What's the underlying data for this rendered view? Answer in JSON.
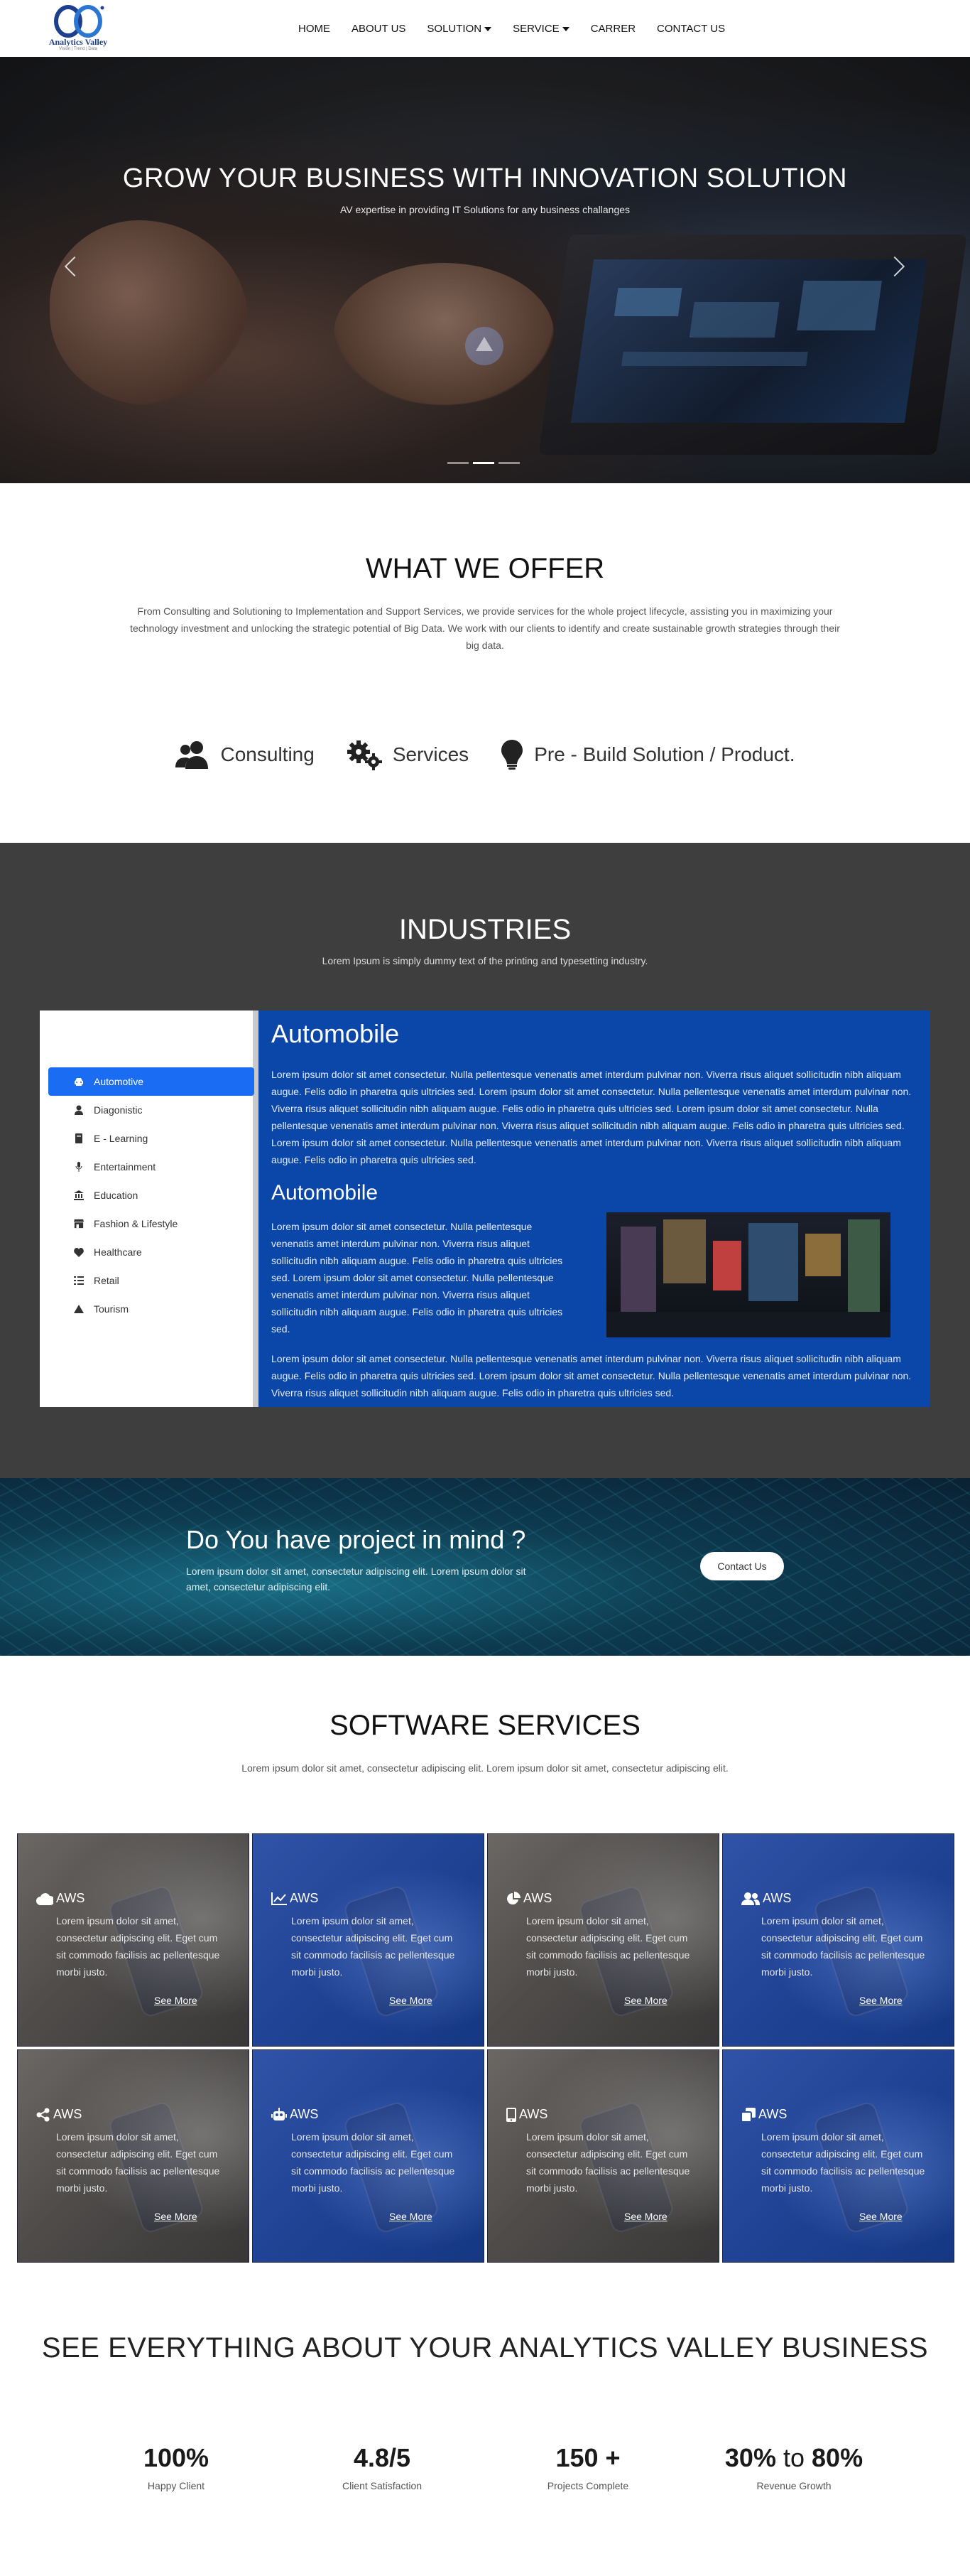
{
  "nav": {
    "logo_name": "Analytics Valley",
    "logo_tagline": "Vision | Trend | Data",
    "items": [
      {
        "label": "HOME",
        "dropdown": false
      },
      {
        "label": "ABOUT US",
        "dropdown": false
      },
      {
        "label": "SOLUTION",
        "dropdown": true
      },
      {
        "label": "SERVICE",
        "dropdown": true
      },
      {
        "label": "CARRER",
        "dropdown": false
      },
      {
        "label": "CONTACT US",
        "dropdown": false
      }
    ]
  },
  "hero": {
    "title": "GROW YOUR BUSINESS WITH INNOVATION SOLUTION",
    "subtitle": "AV expertise in providing IT Solutions for any business challanges",
    "slides": 3,
    "active_slide": 1
  },
  "offer": {
    "title": "WHAT WE OFFER",
    "text": "From Consulting and Solutioning to Implementation and Support Services, we provide services for the whole project lifecycle, assisting you in maximizing your technology investment and unlocking the strategic potential of Big Data. We work with our clients to identify and create sustainable growth strategies through their big data.",
    "items": [
      {
        "label": "Consulting",
        "icon": "users-icon"
      },
      {
        "label": "Services",
        "icon": "gears-icon"
      },
      {
        "label": "Pre - Build Solution / Product.",
        "icon": "lightbulb-icon"
      }
    ]
  },
  "industries": {
    "title": "INDUSTRIES",
    "subtitle": "Lorem Ipsum is simply dummy text of the printing and typesetting industry.",
    "items": [
      {
        "label": "Automotive",
        "icon": "car-icon",
        "active": true
      },
      {
        "label": "Diagonistic",
        "icon": "user-icon",
        "active": false
      },
      {
        "label": "E - Learning",
        "icon": "book-icon",
        "active": false
      },
      {
        "label": "Entertainment",
        "icon": "microphone-icon",
        "active": false
      },
      {
        "label": "Education",
        "icon": "university-icon",
        "active": false
      },
      {
        "label": "Fashion & Lifestyle",
        "icon": "store-icon",
        "active": false
      },
      {
        "label": "Healthcare",
        "icon": "heart-icon",
        "active": false
      },
      {
        "label": "Retail",
        "icon": "list-icon",
        "active": false
      },
      {
        "label": "Tourism",
        "icon": "mountain-icon",
        "active": false
      }
    ],
    "panel": {
      "heading": "Automobile",
      "para1": "Lorem ipsum dolor sit amet consectetur. Nulla pellentesque venenatis amet interdum pulvinar non. Viverra risus aliquet sollicitudin nibh aliquam augue. Felis odio in pharetra quis ultricies sed. Lorem ipsum dolor sit amet consectetur. Nulla pellentesque venenatis amet interdum pulvinar non. Viverra risus aliquet sollicitudin nibh aliquam augue. Felis odio in pharetra quis ultricies sed. Lorem ipsum dolor sit amet consectetur. Nulla pellentesque venenatis amet interdum pulvinar non. Viverra risus aliquet sollicitudin nibh aliquam augue. Felis odio in pharetra quis ultricies sed. Lorem ipsum dolor sit amet consectetur. Nulla pellentesque venenatis amet interdum pulvinar non. Viverra risus aliquet sollicitudin nibh aliquam augue. Felis odio in pharetra quis ultricies sed.",
      "subheading": "Automobile",
      "para2": "Lorem ipsum dolor sit amet consectetur. Nulla pellentesque venenatis amet interdum pulvinar non. Viverra risus aliquet sollicitudin nibh aliquam augue. Felis odio in pharetra quis ultricies sed. Lorem ipsum dolor sit amet consectetur. Nulla pellentesque venenatis amet interdum pulvinar non. Viverra risus aliquet sollicitudin nibh aliquam augue. Felis odio in pharetra quis ultricies sed.",
      "para3": "Lorem ipsum dolor sit amet consectetur. Nulla pellentesque venenatis amet interdum pulvinar non. Viverra risus aliquet sollicitudin nibh aliquam augue. Felis odio in pharetra quis ultricies sed. Lorem ipsum dolor sit amet consectetur. Nulla pellentesque venenatis amet interdum pulvinar non. Viverra risus aliquet sollicitudin nibh aliquam augue. Felis odio in pharetra quis ultricies sed."
    }
  },
  "cta": {
    "title": "Do You have project in mind ?",
    "text": "Lorem ipsum dolor sit amet, consectetur adipiscing elit. Lorem ipsum dolor sit amet, consectetur adipiscing elit.",
    "button": "Contact Us"
  },
  "software": {
    "title": "SOFTWARE SERVICES",
    "subtitle": "Lorem ipsum dolor sit amet, consectetur adipiscing elit. Lorem ipsum dolor sit amet, consectetur adipiscing elit.",
    "cards": [
      {
        "title": "AWS",
        "icon": "cloud-icon",
        "tone": "gray",
        "text": "Lorem ipsum dolor sit amet, consectetur adipiscing elit. Eget cum sit commodo facilisis ac pellentesque morbi justo.",
        "link": "See More"
      },
      {
        "title": "AWS",
        "icon": "chart-line-icon",
        "tone": "blue",
        "text": "Lorem ipsum dolor sit amet, consectetur adipiscing elit. Eget cum sit commodo facilisis ac pellentesque morbi justo.",
        "link": "See More"
      },
      {
        "title": "AWS",
        "icon": "pie-chart-icon",
        "tone": "gray",
        "text": "Lorem ipsum dolor sit amet, consectetur adipiscing elit. Eget cum sit commodo facilisis ac pellentesque morbi justo.",
        "link": "See More"
      },
      {
        "title": "AWS",
        "icon": "users-icon",
        "tone": "blue",
        "text": "Lorem ipsum dolor sit amet, consectetur adipiscing elit. Eget cum sit commodo facilisis ac pellentesque morbi justo.",
        "link": "See More"
      },
      {
        "title": "AWS",
        "icon": "share-icon",
        "tone": "gray",
        "text": "Lorem ipsum dolor sit amet, consectetur adipiscing elit. Eget cum sit commodo facilisis ac pellentesque morbi justo.",
        "link": "See More"
      },
      {
        "title": "AWS",
        "icon": "robot-icon",
        "tone": "blue",
        "text": "Lorem ipsum dolor sit amet, consectetur adipiscing elit. Eget cum sit commodo facilisis ac pellentesque morbi justo.",
        "link": "See More"
      },
      {
        "title": "AWS",
        "icon": "mobile-icon",
        "tone": "gray",
        "text": "Lorem ipsum dolor sit amet, consectetur adipiscing elit. Eget cum sit commodo facilisis ac pellentesque morbi justo.",
        "link": "See More"
      },
      {
        "title": "AWS",
        "icon": "clone-icon",
        "tone": "blue",
        "text": "Lorem ipsum dolor sit amet, consectetur adipiscing elit. Eget cum sit commodo facilisis ac pellentesque morbi justo.",
        "link": "See More"
      }
    ]
  },
  "stats": {
    "title": "SEE EVERYTHING ABOUT YOUR ANALYTICS VALLEY BUSINESS",
    "items": [
      {
        "value": "100%",
        "label": "Happy Client"
      },
      {
        "value": "4.8/5",
        "label": "Client Satisfaction"
      },
      {
        "value": "150 +",
        "label": "Projects Complete"
      },
      {
        "value_a": "30%",
        "value_to": "to",
        "value_b": "80%",
        "label": "Revenue Growth"
      }
    ]
  },
  "colors": {
    "accent_blue": "#1a6cf2",
    "panel_blue": "#0b47a8",
    "dark_section": "#3e3e3e",
    "logo_blue": "#1d3f8f"
  }
}
